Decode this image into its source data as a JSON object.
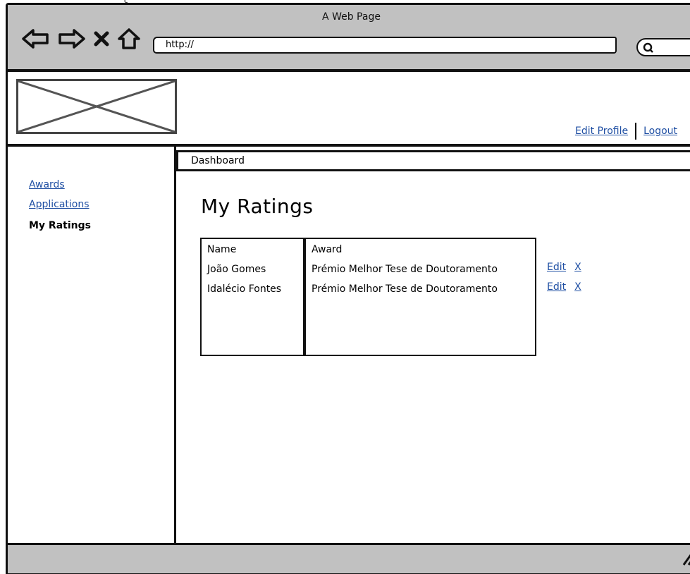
{
  "browser": {
    "window_title": "A Web Page",
    "url": "http://",
    "top_fragment": "ç"
  },
  "header": {
    "links": [
      {
        "label": "Edit Profile"
      },
      {
        "label": "Logout"
      }
    ]
  },
  "sidebar": {
    "items": [
      {
        "label": "Awards",
        "active": false
      },
      {
        "label": "Applications",
        "active": false
      },
      {
        "label": "My Ratings",
        "active": true
      }
    ]
  },
  "tabs": {
    "current": "Dashboard"
  },
  "main": {
    "title": "My Ratings",
    "table": {
      "columns": [
        "Name",
        "Award"
      ],
      "rows": [
        {
          "name": "João Gomes",
          "award": "Prémio Melhor Tese de Doutoramento",
          "edit": "Edit",
          "delete": "X"
        },
        {
          "name": "Idalécio Fontes",
          "award": "Prémio Melhor Tese de Doutoramento",
          "edit": "Edit",
          "delete": "X"
        }
      ]
    }
  },
  "colors": {
    "chrome": "#c1c1c1",
    "link": "#1f4fa3",
    "stroke": "#111111"
  }
}
